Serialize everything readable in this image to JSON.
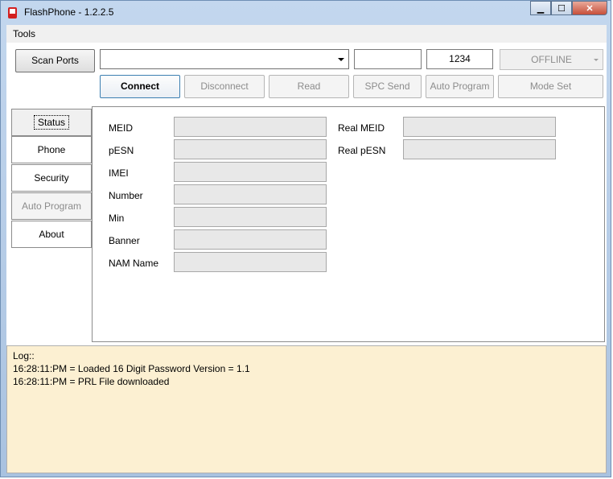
{
  "window": {
    "title": "FlashPhone - 1.2.2.5",
    "minimize": "▁",
    "maximize": "☐",
    "close": "✕"
  },
  "menu": {
    "tools": "Tools"
  },
  "toolbar": {
    "scan_ports": "Scan Ports",
    "port_value": "",
    "field_value": "",
    "spc_value": "1234",
    "status": "OFFLINE",
    "connect": "Connect",
    "disconnect": "Disconnect",
    "read": "Read",
    "spc_send": "SPC Send",
    "auto_program": "Auto Program",
    "mode_set": "Mode Set"
  },
  "tabs": [
    {
      "label": "Status"
    },
    {
      "label": "Phone"
    },
    {
      "label": "Security"
    },
    {
      "label": "Auto Program"
    },
    {
      "label": "About"
    }
  ],
  "status_fields": {
    "left": [
      {
        "label": "MEID",
        "value": ""
      },
      {
        "label": "pESN",
        "value": ""
      },
      {
        "label": "IMEI",
        "value": ""
      },
      {
        "label": "Number",
        "value": ""
      },
      {
        "label": "Min",
        "value": ""
      },
      {
        "label": "Banner",
        "value": ""
      },
      {
        "label": "NAM Name",
        "value": ""
      }
    ],
    "right": [
      {
        "label": "Real MEID",
        "value": ""
      },
      {
        "label": "Real pESN",
        "value": ""
      }
    ]
  },
  "log": {
    "header": "Log::",
    "lines": [
      "16:28:11:PM = Loaded 16 Digit Password Version = 1.1",
      "16:28:11:PM = PRL File downloaded"
    ]
  }
}
